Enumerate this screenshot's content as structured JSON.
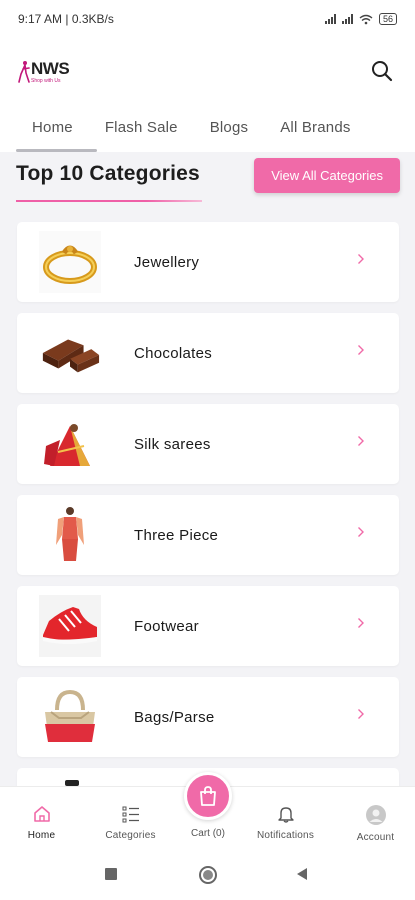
{
  "status_bar": {
    "time": "9:17 AM",
    "speed": "0.3KB/s",
    "separator": "|",
    "battery": "56"
  },
  "header": {
    "logo_text": "NWS",
    "logo_subtext": "Shop with Us",
    "search_icon": "search-icon"
  },
  "tabs": [
    {
      "label": "Home",
      "active": true
    },
    {
      "label": "Flash Sale",
      "active": false
    },
    {
      "label": "Blogs",
      "active": false
    },
    {
      "label": "All Brands",
      "active": false
    }
  ],
  "section": {
    "title": "Top 10 Categories",
    "view_all_label": "View All Categories"
  },
  "categories": [
    {
      "label": "Jewellery",
      "image": "ring-image"
    },
    {
      "label": "Chocolates",
      "image": "chocolate-image"
    },
    {
      "label": "Silk sarees",
      "image": "saree-image"
    },
    {
      "label": "Three Piece",
      "image": "three-piece-image"
    },
    {
      "label": "Footwear",
      "image": "sneaker-image"
    },
    {
      "label": "Bags/Parse",
      "image": "handbag-image"
    }
  ],
  "bottom_nav": {
    "home": "Home",
    "categories": "Categories",
    "cart": "Cart (0)",
    "notifications": "Notifications",
    "account": "Account"
  },
  "colors": {
    "accent": "#f06aa8",
    "background": "#f3f3f6",
    "chevron": "#f06aa8"
  }
}
